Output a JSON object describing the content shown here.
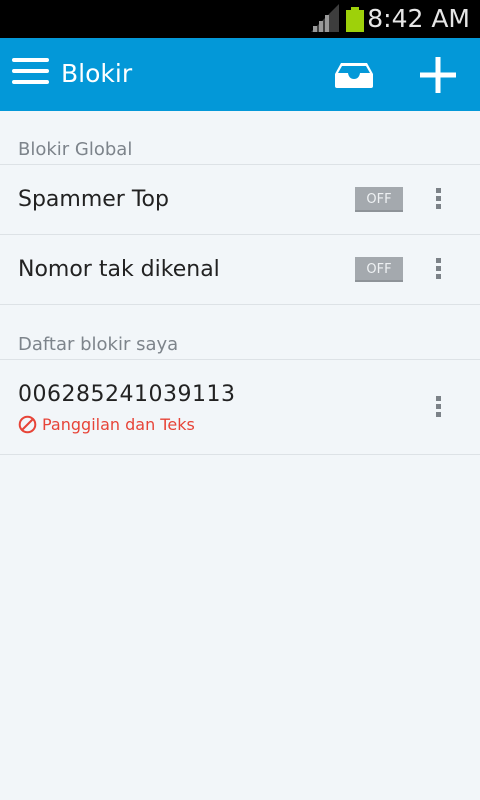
{
  "status_bar": {
    "time": "8:42 AM"
  },
  "app_bar": {
    "title": "Blokir",
    "menu_icon": "hamburger-menu-icon",
    "inbox_icon": "inbox-tray-icon",
    "add_icon": "plus-icon"
  },
  "global_section": {
    "header": "Blokir Global",
    "items": [
      {
        "label": "Spammer Top",
        "toggle": "OFF"
      },
      {
        "label": "Nomor tak dikenal",
        "toggle": "OFF"
      }
    ]
  },
  "my_section": {
    "header": "Daftar blokir saya",
    "items": [
      {
        "number": "006285241039113",
        "type": "Panggilan dan Teks"
      }
    ]
  },
  "colors": {
    "app_bar": "#0398d8",
    "status_bar": "#000000",
    "battery": "#9ed10a",
    "block_red": "#e74438",
    "toggle_off": "#a4a9ae",
    "background": "#f2f6f9"
  }
}
